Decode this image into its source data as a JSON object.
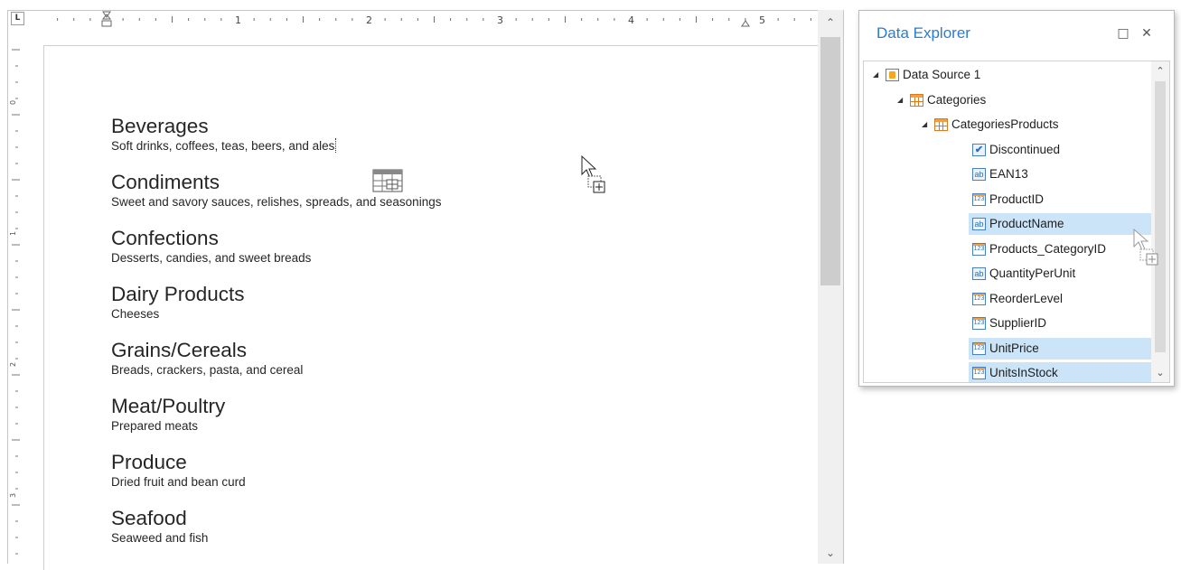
{
  "editor": {
    "ruler_corner_glyph": "L",
    "ruler_numbers": [
      "1",
      "2",
      "3",
      "4",
      "5"
    ],
    "categories": [
      {
        "name": "Beverages",
        "description": "Soft drinks, coffees, teas, beers, and ales"
      },
      {
        "name": "Condiments",
        "description": "Sweet and savory sauces, relishes, spreads, and seasonings"
      },
      {
        "name": "Confections",
        "description": "Desserts, candies, and sweet breads"
      },
      {
        "name": "Dairy Products",
        "description": "Cheeses"
      },
      {
        "name": "Grains/Cereals",
        "description": "Breads, crackers, pasta, and cereal"
      },
      {
        "name": "Meat/Poultry",
        "description": "Prepared meats"
      },
      {
        "name": "Produce",
        "description": "Dried fruit and bean curd"
      },
      {
        "name": "Seafood",
        "description": "Seaweed and fish"
      }
    ],
    "scroll_up_icon": "chevron-up-icon",
    "scroll_down_icon": "chevron-down-icon"
  },
  "explorer": {
    "title": "Data Explorer",
    "restore_glyph": "□",
    "close_glyph": "✕",
    "tree": [
      {
        "label": "Data Source 1",
        "icon": "datasource-icon",
        "level": 0,
        "expanded": true
      },
      {
        "label": "Categories",
        "icon": "table-icon",
        "level": 1,
        "expanded": true
      },
      {
        "label": "CategoriesProducts",
        "icon": "table-icon",
        "level": 2,
        "expanded": true
      },
      {
        "label": "Discontinued",
        "icon": "boolean-field-icon",
        "level": 3,
        "selected": false
      },
      {
        "label": "EAN13",
        "icon": "string-field-icon",
        "level": 3,
        "selected": false
      },
      {
        "label": "ProductID",
        "icon": "number-field-icon",
        "level": 3,
        "selected": false
      },
      {
        "label": "ProductName",
        "icon": "string-field-icon",
        "level": 3,
        "selected": true
      },
      {
        "label": "Products_CategoryID",
        "icon": "number-field-icon",
        "level": 3,
        "selected": false
      },
      {
        "label": "QuantityPerUnit",
        "icon": "string-field-icon",
        "level": 3,
        "selected": false
      },
      {
        "label": "ReorderLevel",
        "icon": "number-field-icon",
        "level": 3,
        "selected": false
      },
      {
        "label": "SupplierID",
        "icon": "number-field-icon",
        "level": 3,
        "selected": false
      },
      {
        "label": "UnitPrice",
        "icon": "number-field-icon",
        "level": 3,
        "selected": true
      },
      {
        "label": "UnitsInStock",
        "icon": "number-field-icon",
        "level": 3,
        "selected": true
      }
    ]
  },
  "colors": {
    "accent": "#2b7bd1",
    "selection": "#cce4f7",
    "field_icon_orange": "#f0a040"
  }
}
